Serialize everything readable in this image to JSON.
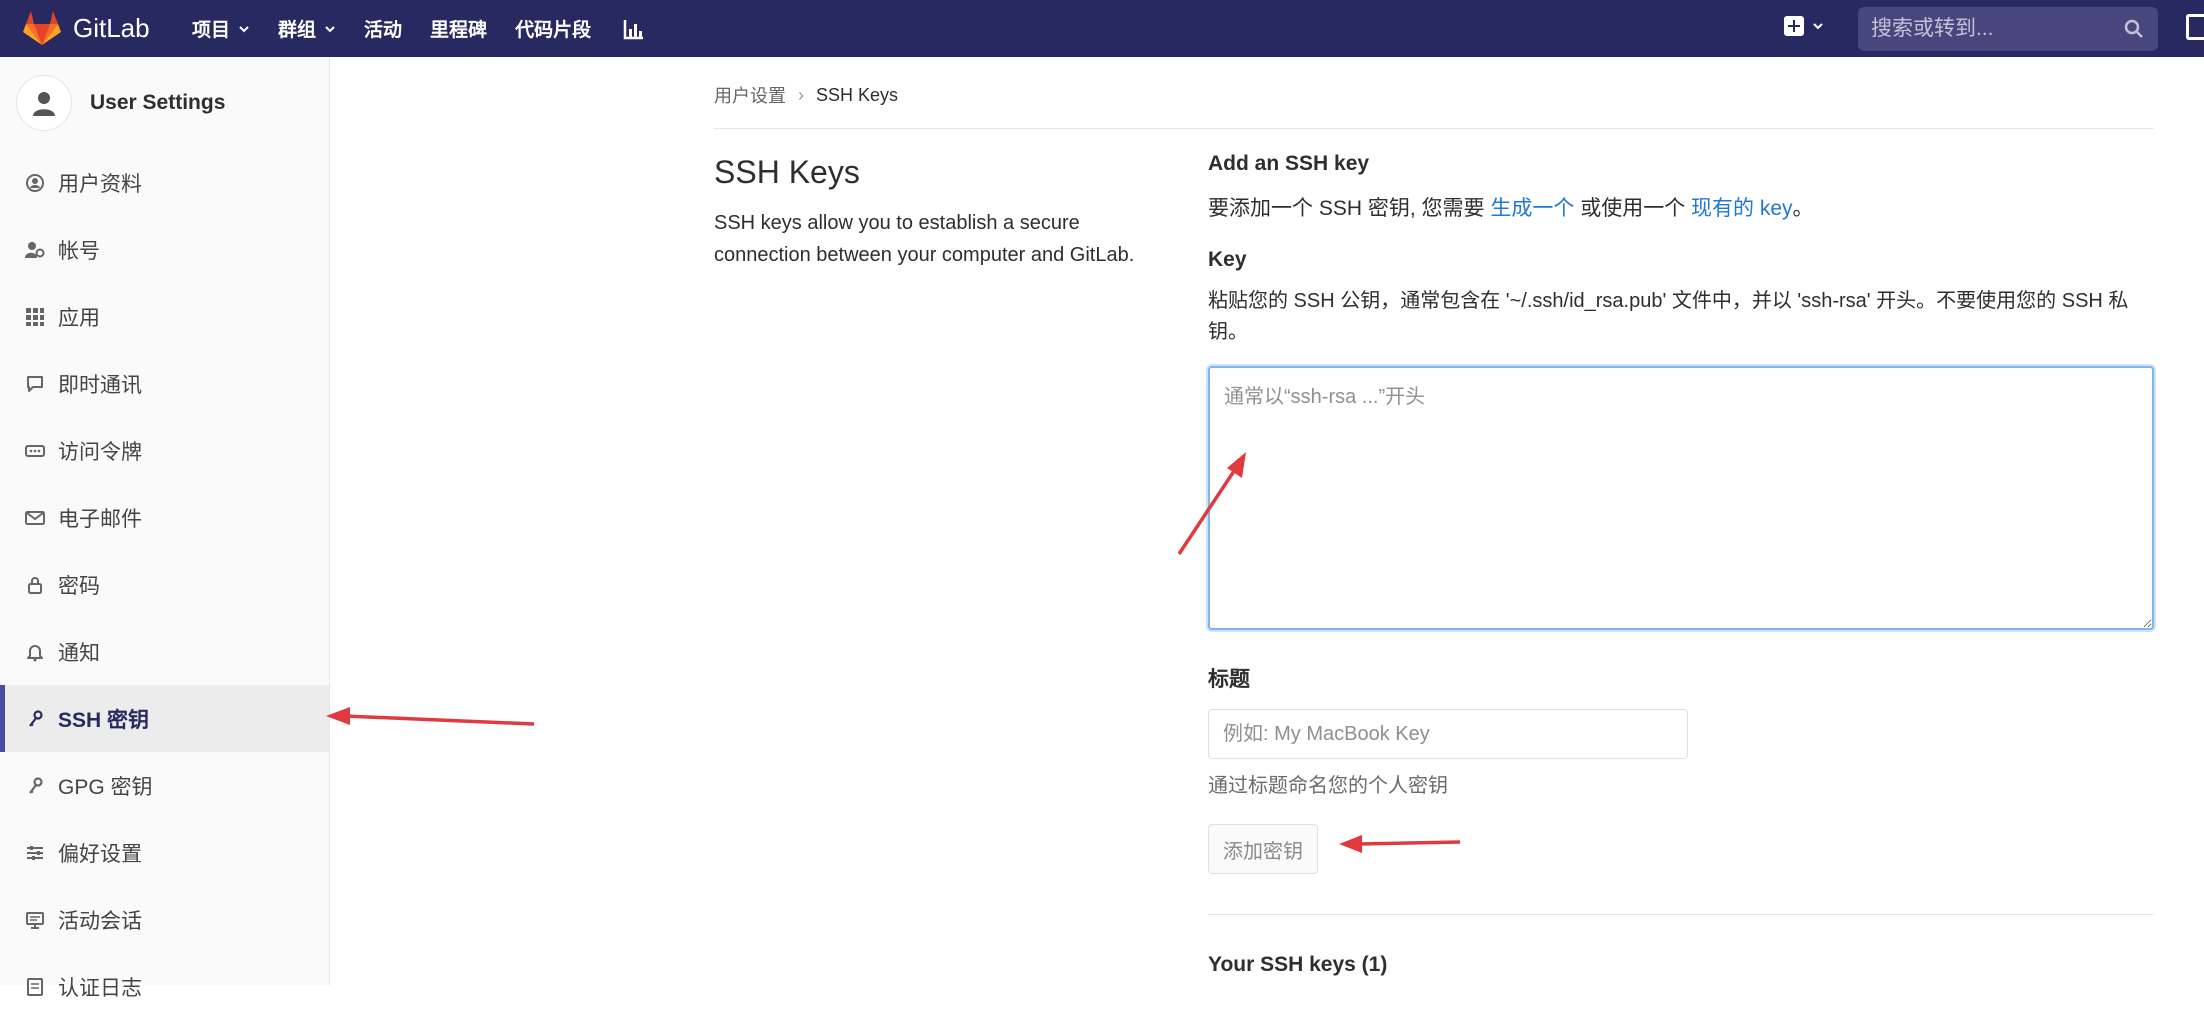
{
  "navbar": {
    "brand": "GitLab",
    "items": [
      {
        "label": "项目",
        "has_dropdown": true
      },
      {
        "label": "群组",
        "has_dropdown": true
      },
      {
        "label": "活动",
        "has_dropdown": false
      },
      {
        "label": "里程碑",
        "has_dropdown": false
      },
      {
        "label": "代码片段",
        "has_dropdown": false
      }
    ],
    "chart_icon": "chart-icon",
    "search_placeholder": "搜索或转到...",
    "brand_color": "#292961"
  },
  "sidebar": {
    "title": "User Settings",
    "items": [
      {
        "label": "用户资料",
        "icon": "profile-icon"
      },
      {
        "label": "帐号",
        "icon": "account-icon"
      },
      {
        "label": "应用",
        "icon": "applications-icon"
      },
      {
        "label": "即时通讯",
        "icon": "chat-icon"
      },
      {
        "label": "访问令牌",
        "icon": "token-icon"
      },
      {
        "label": "电子邮件",
        "icon": "mail-icon"
      },
      {
        "label": "密码",
        "icon": "lock-icon"
      },
      {
        "label": "通知",
        "icon": "bell-icon"
      },
      {
        "label": "SSH 密钥",
        "icon": "key-icon",
        "active": true
      },
      {
        "label": "GPG 密钥",
        "icon": "key-icon"
      },
      {
        "label": "偏好设置",
        "icon": "preferences-icon"
      },
      {
        "label": "活动会话",
        "icon": "monitor-icon"
      },
      {
        "label": "认证日志",
        "icon": "log-icon"
      }
    ]
  },
  "breadcrumb": {
    "parent": "用户设置",
    "separator": "›",
    "current": "SSH Keys"
  },
  "left": {
    "title": "SSH Keys",
    "description": "SSH keys allow you to establish a secure connection between your computer and GitLab."
  },
  "form": {
    "add_heading": "Add an SSH key",
    "add_text_1": "要添加一个 SSH 密钥, 您需要 ",
    "add_link_1": "生成一个",
    "add_text_2": " 或使用一个 ",
    "add_link_2": "现有的 key",
    "add_text_3": "。",
    "key_label": "Key",
    "key_help": "粘贴您的 SSH 公钥，通常包含在 '~/.ssh/id_rsa.pub' 文件中，并以 'ssh-rsa' 开头。不要使用您的 SSH 私钥。",
    "key_placeholder": "通常以“ssh-rsa ...”开头",
    "title_label": "标题",
    "title_placeholder": "例如: My MacBook Key",
    "title_help": "通过标题命名您的个人密钥",
    "submit_label": "添加密钥",
    "your_keys_heading": "Your SSH keys (1)",
    "link_color": "#1f78d1"
  },
  "annotations": {
    "arrow_color": "#e0393e"
  }
}
